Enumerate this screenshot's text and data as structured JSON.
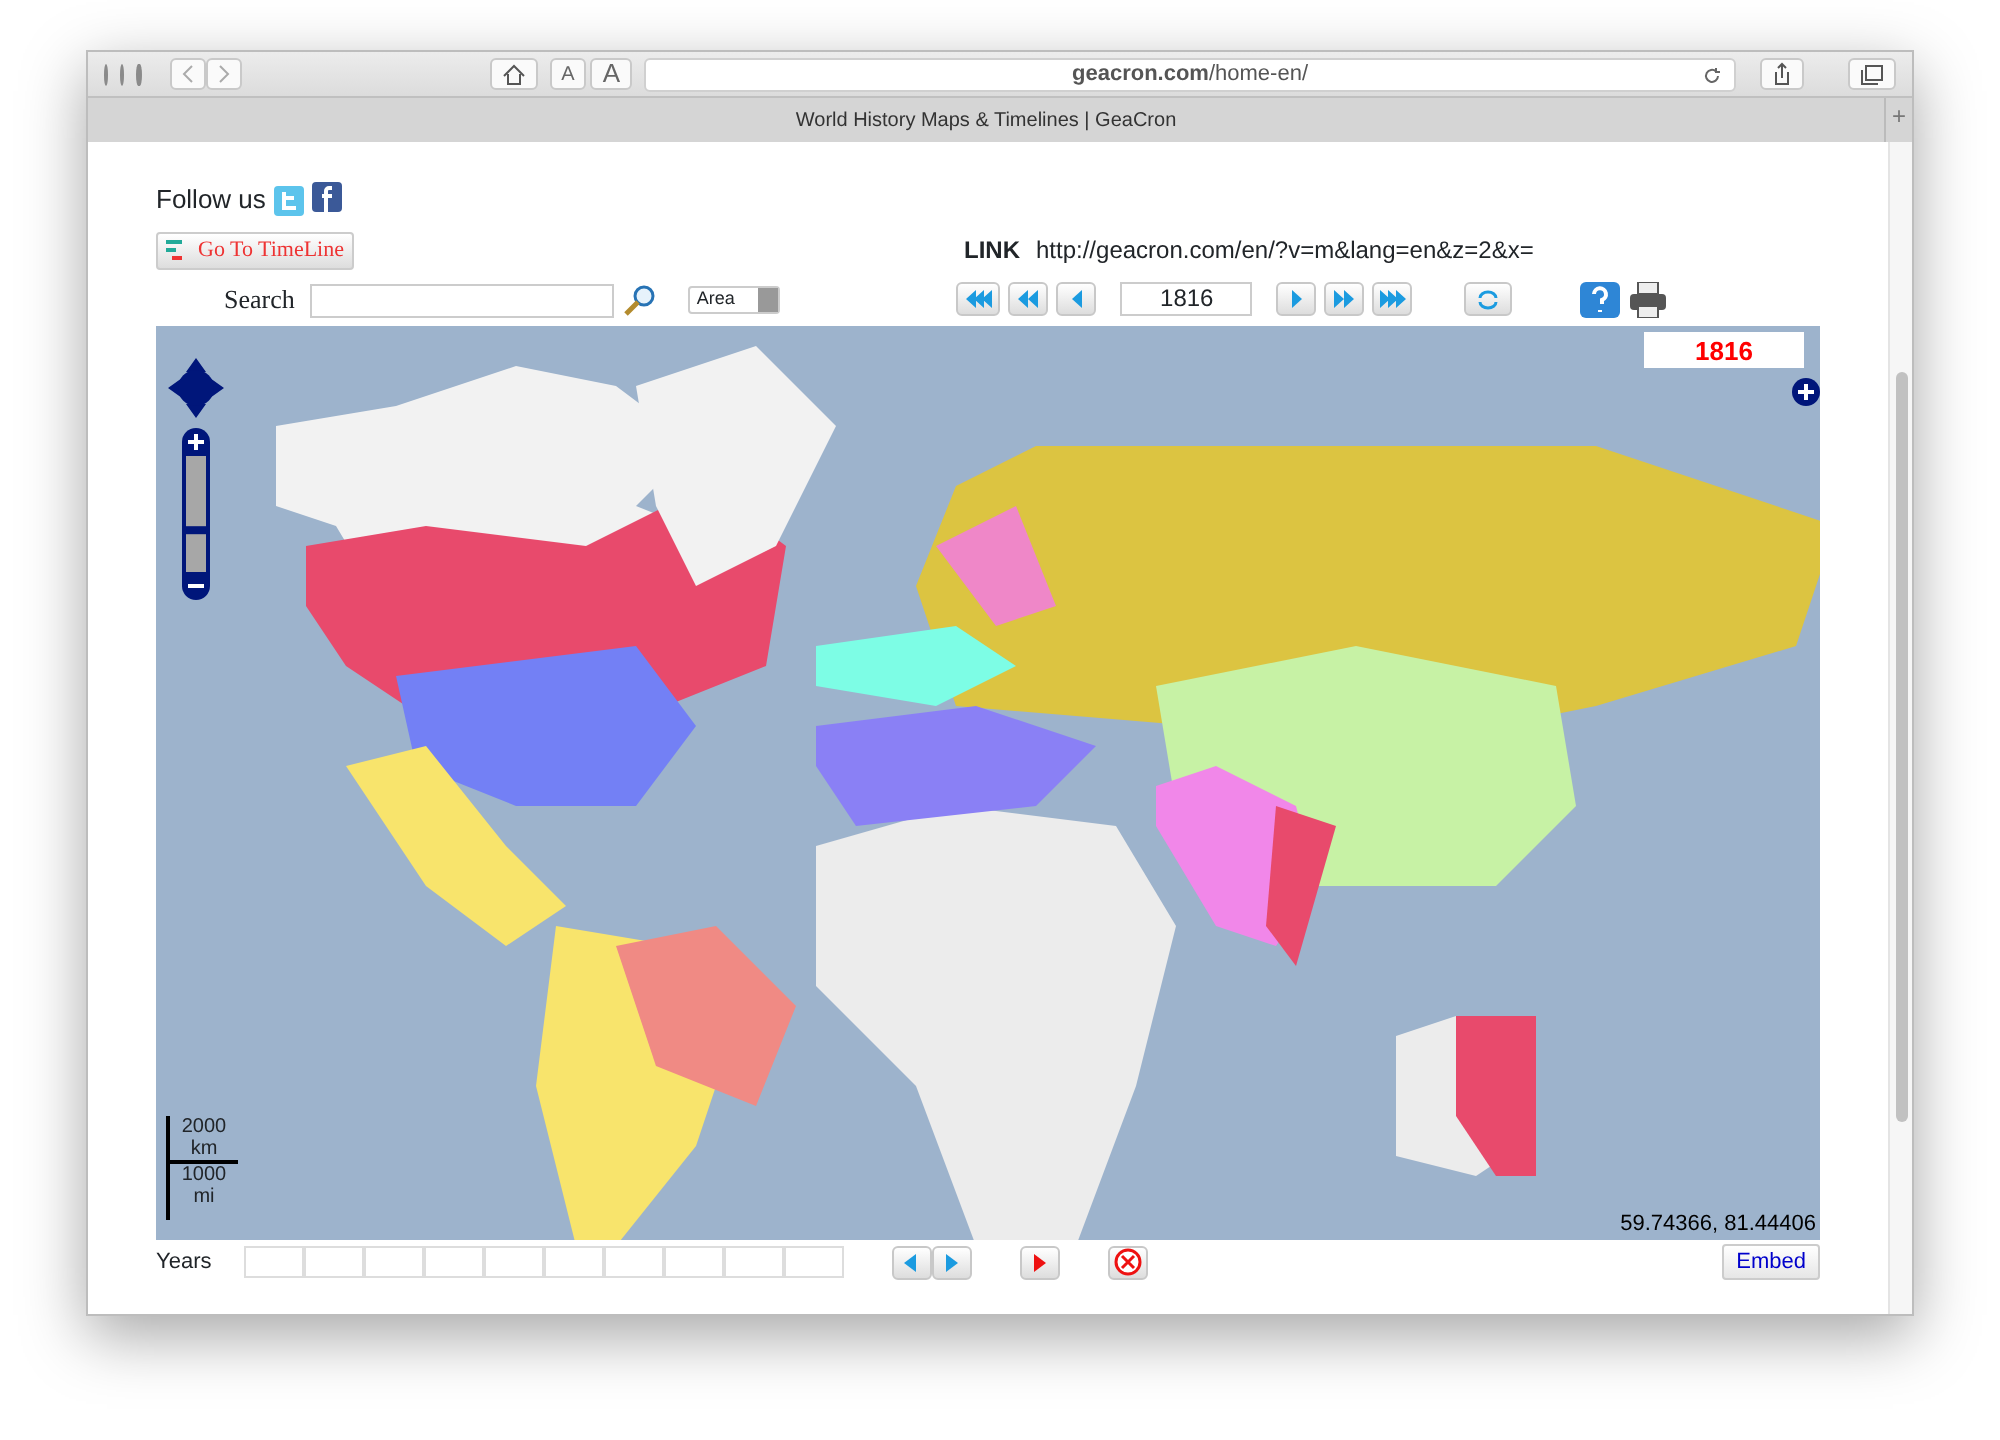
{
  "browser": {
    "font_buttons": [
      "A",
      "A"
    ],
    "url": "**geacron.com**/home-en/",
    "tab_title": "World History Maps & Timelines | GeaCron",
    "new_tab": "+"
  },
  "header": {
    "follow_label": "Follow us",
    "timeline_button": "Go To TimeLine",
    "link_label": "LINK",
    "link_value": "http://geacron.com/en/?v=m&lang=en&z=2&x="
  },
  "toolbar": {
    "search_label": "Search",
    "mode_select": "Area",
    "year_value": "1816"
  },
  "map": {
    "year_badge": "1816",
    "zoom": {
      "level": 0.35
    },
    "scale": [
      "2000",
      "km",
      "1000",
      "mi"
    ],
    "coordinates": "59.74366, 81.44406"
  },
  "footer": {
    "years_label": "Years",
    "embed_button": "Embed"
  }
}
